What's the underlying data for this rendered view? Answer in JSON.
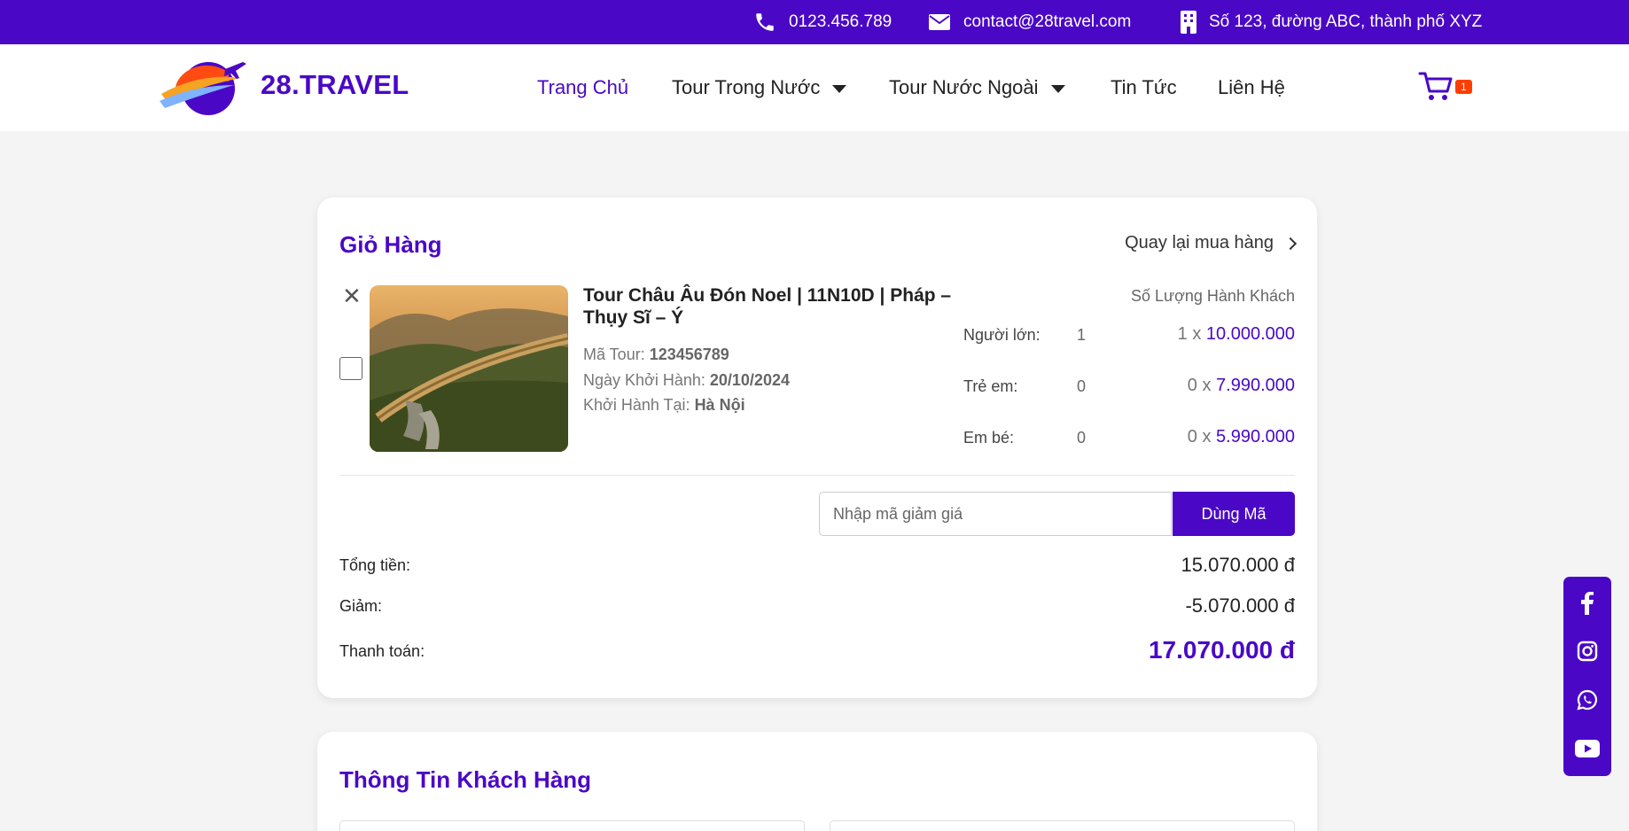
{
  "topbar": {
    "phone": "0123.456.789",
    "email": "contact@28travel.com",
    "address": "Số 123, đường ABC, thành phố XYZ"
  },
  "brand": {
    "name": "28.TRAVEL"
  },
  "nav": {
    "home": "Trang Chủ",
    "domestic": "Tour Trong Nước",
    "international": "Tour Nước Ngoài",
    "news": "Tin Tức",
    "contact": "Liên Hệ"
  },
  "cart": {
    "count": "1"
  },
  "cart_card": {
    "title": "Giỏ Hàng",
    "back_label": "Quay lại mua hàng",
    "remove_symbol": "✕",
    "item": {
      "name": "Tour Châu Âu Đón Noel | 11N10D | Pháp – Thụy Sĩ – Ý",
      "code_label": "Mã Tour:",
      "code": "123456789",
      "date_label": "Ngày Khởi Hành:",
      "date": "20/10/2024",
      "depart_label": "Khởi Hành Tại:",
      "depart": "Hà Nội"
    },
    "passengers": {
      "heading": "Số Lượng Hành Khách",
      "rows": [
        {
          "label": "Người lớn:",
          "count": "1",
          "mult": "1 x ",
          "price": "10.000.000"
        },
        {
          "label": "Trẻ em:",
          "count": "0",
          "mult": "0 x ",
          "price": "7.990.000"
        },
        {
          "label": "Em bé:",
          "count": "0",
          "mult": "0 x ",
          "price": "5.990.000"
        }
      ]
    },
    "coupon": {
      "placeholder": "Nhập mã giảm giá",
      "button": "Dùng Mã"
    },
    "summary": {
      "total_label": "Tổng tiền:",
      "total": "15.070.000 đ",
      "discount_label": "Giảm:",
      "discount": "-5.070.000 đ",
      "pay_label": "Thanh toán:",
      "pay": "17.070.000 đ"
    }
  },
  "customer_card": {
    "title": "Thông Tin Khách Hàng"
  },
  "colors": {
    "primary": "#4a08c6",
    "badge": "#ff3d00",
    "background": "#f4f4f4"
  },
  "social_icons": [
    "facebook-icon",
    "instagram-icon",
    "whatsapp-icon",
    "youtube-icon"
  ]
}
